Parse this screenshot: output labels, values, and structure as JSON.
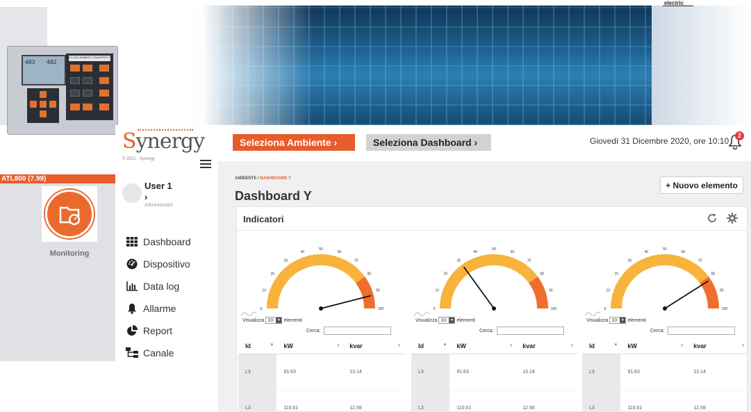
{
  "banner": {
    "brand": "electric"
  },
  "device": {
    "screen_left_value": "403",
    "screen_right_value": "402",
    "panel_label": "ATL 800 AMBIENT TRANSFER SWITCH"
  },
  "left_panel": {
    "device_bar": "ATL800 (7.99)",
    "tile_label": "Monitoring"
  },
  "sidebar": {
    "logo_first": "S",
    "logo_rest": "ynergy",
    "copyright": "© 2021 - Synergy",
    "user_name": "User 1",
    "user_chevron": "›",
    "user_role": "Administrator",
    "nav": [
      {
        "label": "Dashboard",
        "icon": "grid-icon"
      },
      {
        "label": "Dispositivo",
        "icon": "gauge-icon"
      },
      {
        "label": "Data log",
        "icon": "bar-chart-icon"
      },
      {
        "label": "Allarme",
        "icon": "bell-icon"
      },
      {
        "label": "Report",
        "icon": "pie-chart-icon"
      },
      {
        "label": "Canale",
        "icon": "sitemap-icon"
      }
    ]
  },
  "topbar": {
    "env_button": "Seleziona Ambiente  ›",
    "dash_button": "Seleziona Dashboard  ›",
    "datetime": "Giovedì 31 Dicembre 2020, ore 10:10",
    "notification_count": "2"
  },
  "page": {
    "breadcrumb_root": "AMBIENTE",
    "breadcrumb_sep": "/",
    "breadcrumb_current": "DASHBOARD Y",
    "title": "Dashboard Y",
    "new_button": "+ Nuovo elemento"
  },
  "panel": {
    "title": "Indicatori",
    "widgets": [
      {
        "gauge_value": 92
      },
      {
        "gauge_value": 30
      },
      {
        "gauge_value": 82
      }
    ],
    "gauge_ticks": [
      "0",
      "10",
      "20",
      "30",
      "40",
      "50",
      "60",
      "70",
      "80",
      "90",
      "100"
    ],
    "show_prefix": "Visualizza",
    "show_value": "10",
    "show_suffix": "elementi",
    "search_label": "Cerca:",
    "columns": [
      "Id",
      "kW",
      "kvar"
    ],
    "rows": [
      [
        "L3",
        "91.63",
        "13.14"
      ],
      [
        "L3",
        "110.61",
        "12.58"
      ]
    ]
  },
  "colors": {
    "accent": "#e85c2c",
    "gauge_yellow": "#f7b33b",
    "gauge_orange": "#ef6e2e"
  }
}
